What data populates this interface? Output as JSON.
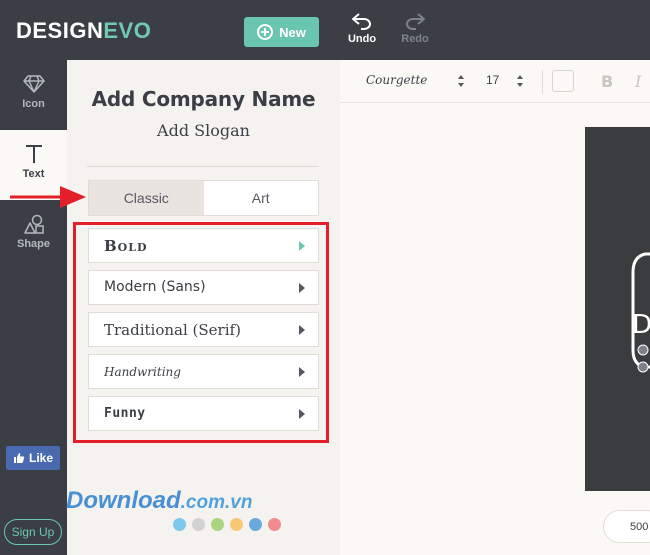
{
  "header": {
    "logo_main": "DESIGN",
    "logo_accent": "EVO",
    "new_label": "New",
    "undo_label": "Undo",
    "redo_label": "Redo"
  },
  "sidebar": {
    "items": [
      {
        "label": "Icon",
        "icon": "diamond-icon"
      },
      {
        "label": "Text",
        "icon": "text-t-icon"
      },
      {
        "label": "Shape",
        "icon": "shapes-icon"
      }
    ],
    "active": "Text",
    "like_label": "Like",
    "signup_label": "Sign Up"
  },
  "panel": {
    "company_name": "Add Company Name",
    "slogan": "Add Slogan",
    "tabs": [
      {
        "label": "Classic",
        "active": true
      },
      {
        "label": "Art",
        "active": false
      }
    ],
    "font_categories": [
      {
        "label": "Bold",
        "highlighted": true
      },
      {
        "label": "Modern (Sans)",
        "highlighted": false
      },
      {
        "label": "Traditional (Serif)",
        "highlighted": false
      },
      {
        "label": "Handwriting",
        "highlighted": false
      },
      {
        "label": "Funny",
        "highlighted": false
      }
    ],
    "palette": [
      "#7ec7ec",
      "#d2d2d2",
      "#a9d57e",
      "#f6c874",
      "#6aa9db",
      "#f28b8e"
    ]
  },
  "watermark": {
    "main": "Download",
    "suffix": ".com.vn"
  },
  "format_bar": {
    "font_name": "Courgette",
    "font_size": "17",
    "bold_label": "B",
    "italic_label": "I"
  },
  "canvas": {
    "zoom_value": "500"
  },
  "colors": {
    "dark": "#3b3f45",
    "accent": "#6ac6ae",
    "highlight_box": "#e3202a"
  }
}
